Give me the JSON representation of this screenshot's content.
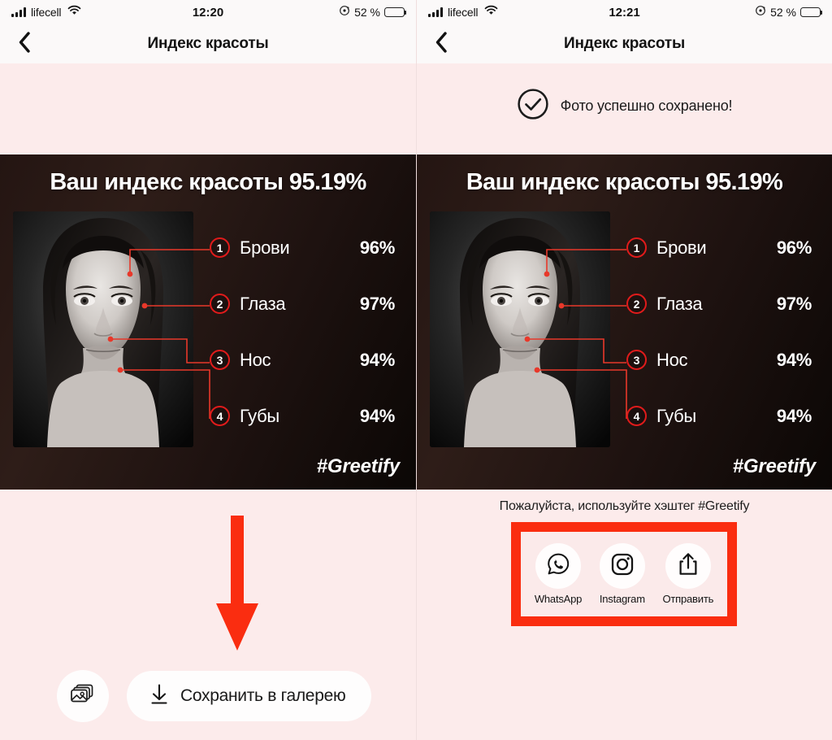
{
  "colors": {
    "page_bg": "#fcebeb",
    "navbar_bg": "#fbf9f9",
    "card_dark": "#241512",
    "accent_red": "#e01b1b",
    "annotation_red": "#fa2d10",
    "text_dark": "#131313",
    "text_light": "#ffffff"
  },
  "screens": [
    {
      "id": "left",
      "status": {
        "carrier": "lifecell",
        "time": "12:20",
        "battery_pct": "52 %",
        "signal_icon": "signal-bars-icon",
        "wifi_icon": "wifi-icon",
        "rotation_lock_icon": "rotation-lock-icon",
        "battery_icon": "battery-icon"
      },
      "nav": {
        "back_icon": "chevron-left-icon",
        "title": "Индекс красоты"
      },
      "toast": {
        "visible": false,
        "icon": "check-circle-icon",
        "text": ""
      },
      "card": {
        "title": "Ваш индекс красоты 95.19%",
        "score": "95.19%",
        "hashtag": "#Greetify",
        "portrait_alt": "black-and-white portrait photo with facial landmark markers",
        "features": [
          {
            "num": "1",
            "name": "Брови",
            "value": "96%"
          },
          {
            "num": "2",
            "name": "Глаза",
            "value": "97%"
          },
          {
            "num": "3",
            "name": "Нос",
            "value": "94%"
          },
          {
            "num": "4",
            "name": "Губы",
            "value": "94%"
          }
        ]
      },
      "lower": {
        "kind": "save",
        "arrow_annotation": "red-down-arrow",
        "gallery_button": {
          "icon": "gallery-photos-icon",
          "label": ""
        },
        "save_button": {
          "icon": "download-icon",
          "label": "Сохранить в галерею"
        }
      }
    },
    {
      "id": "right",
      "status": {
        "carrier": "lifecell",
        "time": "12:21",
        "battery_pct": "52 %",
        "signal_icon": "signal-bars-icon",
        "wifi_icon": "wifi-icon",
        "rotation_lock_icon": "rotation-lock-icon",
        "battery_icon": "battery-icon"
      },
      "nav": {
        "back_icon": "chevron-left-icon",
        "title": "Индекс красоты"
      },
      "toast": {
        "visible": true,
        "icon": "check-circle-icon",
        "text": "Фото успешно сохранено!"
      },
      "card": {
        "title": "Ваш индекс красоты 95.19%",
        "score": "95.19%",
        "hashtag": "#Greetify",
        "portrait_alt": "black-and-white portrait photo with facial landmark markers",
        "features": [
          {
            "num": "1",
            "name": "Брови",
            "value": "96%"
          },
          {
            "num": "2",
            "name": "Глаза",
            "value": "97%"
          },
          {
            "num": "3",
            "name": "Нос",
            "value": "94%"
          },
          {
            "num": "4",
            "name": "Губы",
            "value": "94%"
          }
        ]
      },
      "lower": {
        "kind": "share",
        "hint": "Пожалуйста, используйте хэштег #Greetify",
        "highlight_annotation": "red-rectangle-highlight",
        "share_items": [
          {
            "icon": "whatsapp-icon",
            "label": "WhatsApp"
          },
          {
            "icon": "instagram-icon",
            "label": "Instagram"
          },
          {
            "icon": "share-up-icon",
            "label": "Отправить"
          }
        ]
      }
    }
  ]
}
